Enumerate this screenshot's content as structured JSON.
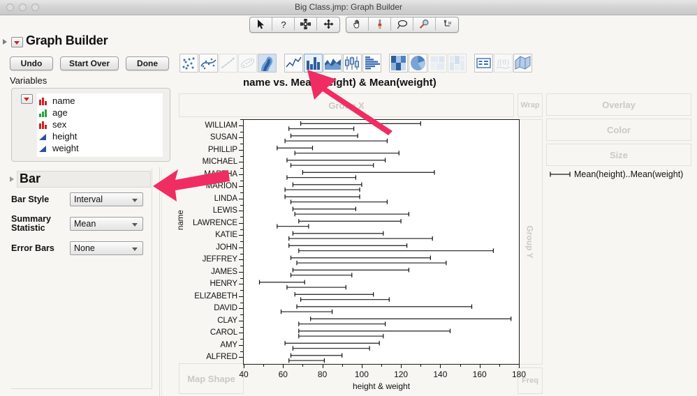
{
  "window": {
    "title": "Big Class.jmp: Graph Builder",
    "traffic_lights": [
      "close",
      "minimize",
      "zoom"
    ]
  },
  "toolbar": {
    "groups": [
      {
        "name": "selection-tools",
        "items": [
          {
            "icon": "arrow-cursor-icon",
            "label": "Arrow"
          },
          {
            "icon": "question-mark-icon",
            "label": "Help"
          },
          {
            "icon": "crosshair-icon",
            "label": "Crosshairs"
          },
          {
            "icon": "move-icon",
            "label": "Move"
          }
        ]
      },
      {
        "name": "view-tools",
        "items": [
          {
            "icon": "hand-icon",
            "label": "Grabber"
          },
          {
            "icon": "brush-icon",
            "label": "Brush"
          },
          {
            "icon": "lasso-icon",
            "label": "Lasso"
          },
          {
            "icon": "magnifier-icon",
            "label": "Magnifier"
          },
          {
            "icon": "annotate-icon",
            "label": "Annotate"
          }
        ]
      }
    ]
  },
  "outline": {
    "title": "Graph Builder"
  },
  "buttons": {
    "undo": "Undo",
    "start_over": "Start Over",
    "done": "Done"
  },
  "graph_types": [
    {
      "name": "points",
      "icon": "points-icon",
      "selected": false,
      "dim": false
    },
    {
      "name": "smoother",
      "icon": "smoother-icon",
      "selected": false,
      "dim": false
    },
    {
      "name": "line-of-fit",
      "icon": "line-of-fit-icon",
      "selected": false,
      "dim": true
    },
    {
      "name": "ellipse",
      "icon": "ellipse-icon",
      "selected": false,
      "dim": true
    },
    {
      "name": "contour",
      "icon": "contour-icon",
      "selected": false,
      "dim": false
    },
    {
      "name": "line",
      "icon": "line-icon",
      "selected": false,
      "dim": false
    },
    {
      "name": "bar",
      "icon": "bar-icon",
      "selected": true,
      "dim": false
    },
    {
      "name": "area",
      "icon": "area-icon",
      "selected": false,
      "dim": false
    },
    {
      "name": "box-plot",
      "icon": "box-plot-icon",
      "selected": false,
      "dim": false
    },
    {
      "name": "histogram",
      "icon": "histogram-icon",
      "selected": false,
      "dim": false
    },
    {
      "name": "heatmap",
      "icon": "heatmap-icon",
      "selected": false,
      "dim": false
    },
    {
      "name": "pie",
      "icon": "pie-icon",
      "selected": false,
      "dim": false
    },
    {
      "name": "treemap",
      "icon": "treemap-icon",
      "selected": false,
      "dim": true
    },
    {
      "name": "mosaic",
      "icon": "mosaic-icon",
      "selected": false,
      "dim": true
    },
    {
      "name": "caption-box",
      "icon": "caption-box-icon",
      "selected": false,
      "dim": false
    },
    {
      "name": "formula",
      "icon": "formula-icon",
      "selected": false,
      "dim": true
    },
    {
      "name": "map-shapes",
      "icon": "map-shapes-icon",
      "selected": false,
      "dim": false
    }
  ],
  "variables": {
    "label": "Variables",
    "items": [
      {
        "name": "name",
        "type": "nominal",
        "icon": "nominal-red-icon"
      },
      {
        "name": "age",
        "type": "ordinal",
        "icon": "ordinal-green-icon"
      },
      {
        "name": "sex",
        "type": "nominal",
        "icon": "nominal-red-icon"
      },
      {
        "name": "height",
        "type": "continuous",
        "icon": "continuous-blue-icon"
      },
      {
        "name": "weight",
        "type": "continuous",
        "icon": "continuous-blue-icon"
      }
    ]
  },
  "bar_panel": {
    "title": "Bar",
    "rows": [
      {
        "label": "Bar Style",
        "value": "Interval"
      },
      {
        "label": "Summary Statistic",
        "label_line1": "Summary",
        "label_line2": "Statistic",
        "value": "Mean"
      },
      {
        "label": "Error Bars",
        "value": "None"
      }
    ]
  },
  "dropzones": {
    "group_x": "Group X",
    "wrap": "Wrap",
    "overlay": "Overlay",
    "color": "Color",
    "size": "Size",
    "group_y": "Group Y",
    "map_shape": "Map Shape",
    "freq": "Freq"
  },
  "legend": {
    "entry": "Mean(height)..Mean(weight)",
    "glyph": "interval-bar-glyph"
  },
  "colors": {
    "arrow": "#ef2d62",
    "selection_highlight": "#cfe2f5",
    "nominal_icon": "#cc2222",
    "ordinal_icon": "#2aa33a",
    "continuous_icon": "#2d4fa0",
    "panel_bg": "#f7f6f2",
    "plot_bg": "#ffffff"
  },
  "annotations": [
    {
      "name": "arrow-to-bar-icon",
      "color": "#ef2d62"
    },
    {
      "name": "arrow-to-bar-panel",
      "color": "#ef2d62"
    }
  ],
  "chart_data": {
    "type": "bar",
    "title": "name vs. Mean(height) & Mean(weight)",
    "xlabel": "height & weight",
    "ylabel": "name",
    "xlim": [
      40,
      180
    ],
    "xticks": [
      40,
      60,
      80,
      100,
      120,
      140,
      160,
      180
    ],
    "grid": false,
    "legend_position": "right",
    "bar_style": "Interval",
    "summary_statistic": "Mean",
    "error_bars": "None",
    "series": [
      {
        "name": "Mean(height)",
        "label": "Mean(height)"
      },
      {
        "name": "Mean(weight)",
        "label": "Mean(weight)"
      }
    ],
    "categories": [
      "WILLIAM",
      "SUSAN",
      "PHILLIP",
      "MICHAEL",
      "MARTHA",
      "MARION",
      "LINDA",
      "LEWIS",
      "LAWRENCE",
      "KATIE",
      "JOHN",
      "JEFFREY",
      "JAMES",
      "HENRY",
      "ELIZABETH",
      "DAVID",
      "CLAY",
      "CAROL",
      "AMY",
      "ALFRED"
    ],
    "intervals": [
      {
        "category": "WILLIAM",
        "low": 69,
        "high": 130
      },
      {
        "category": "SUSAN",
        "low": 64,
        "high": 98
      },
      {
        "category": "PHILLIP",
        "low": 57,
        "high": 75
      },
      {
        "category": "MICHAEL",
        "low": 62,
        "high": 112
      },
      {
        "category": "MARTHA",
        "low": 70,
        "high": 137
      },
      {
        "category": "MARION",
        "low": 65,
        "high": 100
      },
      {
        "category": "LINDA",
        "low": 61,
        "high": 99
      },
      {
        "category": "LEWIS",
        "low": 65,
        "high": 97
      },
      {
        "category": "LAWRENCE",
        "low": 68,
        "high": 120
      },
      {
        "category": "KATIE",
        "low": 65,
        "high": 111
      },
      {
        "category": "JOHN",
        "low": 63,
        "high": 123
      },
      {
        "category": "JEFFREY",
        "low": 64,
        "high": 135
      },
      {
        "category": "JAMES",
        "low": 65,
        "high": 124
      },
      {
        "category": "HENRY",
        "low": 48,
        "high": 71
      },
      {
        "category": "ELIZABETH",
        "low": 66,
        "high": 106
      },
      {
        "category": "DAVID",
        "low": 67,
        "high": 156
      },
      {
        "category": "CLAY",
        "low": 74,
        "high": 176
      },
      {
        "category": "CAROL",
        "low": 68,
        "high": 145
      },
      {
        "category": "AMY",
        "low": 61,
        "high": 109
      },
      {
        "category": "ALFRED",
        "low": 64,
        "high": 90
      }
    ],
    "intervals_secondary": [
      {
        "category": "WILLIAM",
        "low": 63,
        "high": 96
      },
      {
        "category": "SUSAN",
        "low": 61,
        "high": 113
      },
      {
        "category": "PHILLIP",
        "low": 66,
        "high": 119
      },
      {
        "category": "MICHAEL",
        "low": 64,
        "high": 106
      },
      {
        "category": "MARTHA",
        "low": 62,
        "high": 97
      },
      {
        "category": "MARION",
        "low": 61,
        "high": 99
      },
      {
        "category": "LINDA",
        "low": 64,
        "high": 113
      },
      {
        "category": "LEWIS",
        "low": 66,
        "high": 124
      },
      {
        "category": "LAWRENCE",
        "low": 57,
        "high": 73
      },
      {
        "category": "KATIE",
        "low": 63,
        "high": 136
      },
      {
        "category": "JOHN",
        "low": 68,
        "high": 167
      },
      {
        "category": "JEFFREY",
        "low": 67,
        "high": 143
      },
      {
        "category": "JAMES",
        "low": 64,
        "high": 95
      },
      {
        "category": "HENRY",
        "low": 62,
        "high": 92
      },
      {
        "category": "ELIZABETH",
        "low": 69,
        "high": 114
      },
      {
        "category": "DAVID",
        "low": 59,
        "high": 85
      },
      {
        "category": "CLAY",
        "low": 68,
        "high": 112
      },
      {
        "category": "CAROL",
        "low": 68,
        "high": 111
      },
      {
        "category": "AMY",
        "low": 65,
        "high": 104
      },
      {
        "category": "ALFRED",
        "low": 63,
        "high": 81
      }
    ]
  }
}
